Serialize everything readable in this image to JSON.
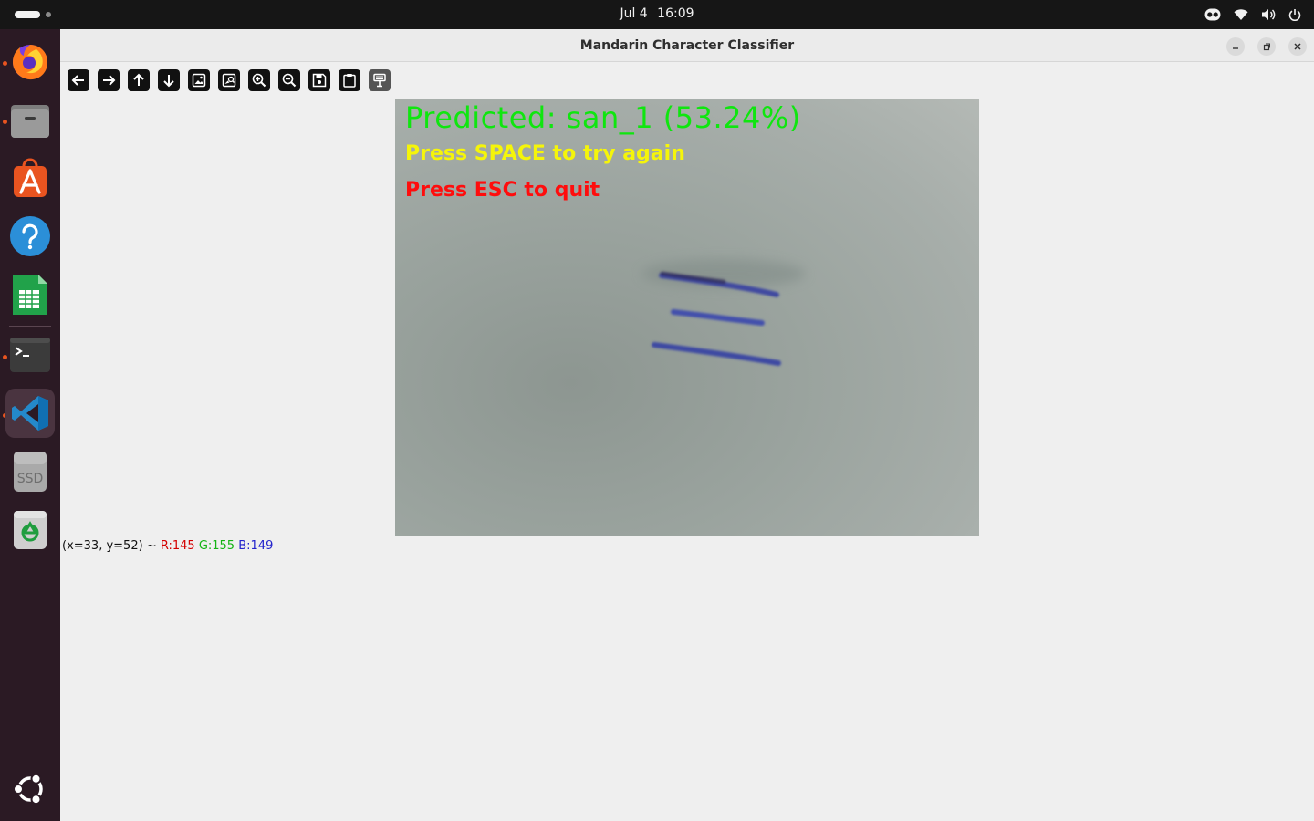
{
  "topbar": {
    "date": "Jul 4",
    "time": "16:09"
  },
  "dock": {
    "items": [
      {
        "name": "firefox",
        "icon": "firefox-icon",
        "running": true
      },
      {
        "name": "files",
        "icon": "files-icon",
        "running": true
      },
      {
        "name": "app-center",
        "icon": "app-center-icon",
        "running": false
      },
      {
        "name": "help",
        "icon": "help-icon",
        "running": false
      },
      {
        "name": "calc",
        "icon": "spreadsheet-icon",
        "running": false
      },
      {
        "name": "terminal",
        "icon": "terminal-icon",
        "running": true
      },
      {
        "name": "vscode",
        "icon": "vscode-icon",
        "running": true,
        "active": true
      },
      {
        "name": "ssd",
        "label": "SSD",
        "icon": "drive-icon",
        "running": false
      },
      {
        "name": "trash",
        "icon": "trash-icon",
        "running": false
      }
    ]
  },
  "window": {
    "title": "Mandarin Character Classifier",
    "toolbar": [
      "arrow-left-icon",
      "arrow-right-icon",
      "arrow-up-icon",
      "arrow-down-icon",
      "image-icon",
      "image-zoom-icon",
      "zoom-in-icon",
      "zoom-out-icon",
      "save-icon",
      "clipboard-icon",
      "properties-icon"
    ],
    "overlay": {
      "prediction": "Predicted: san_1 (53.24%)",
      "retry_hint": "Press SPACE to try again",
      "quit_hint": "Press ESC to quit"
    },
    "status": {
      "coords": "(x=33, y=52) ~",
      "r": "R:145",
      "g": "G:155",
      "b": "B:149"
    }
  },
  "colors": {
    "prediction": "#0fe60f",
    "retry_hint": "#f5f50a",
    "quit_hint": "#ff0d0d",
    "ink": "#3f4aa0",
    "dock_bg": "#2b1a24",
    "accent": "#e95420"
  }
}
